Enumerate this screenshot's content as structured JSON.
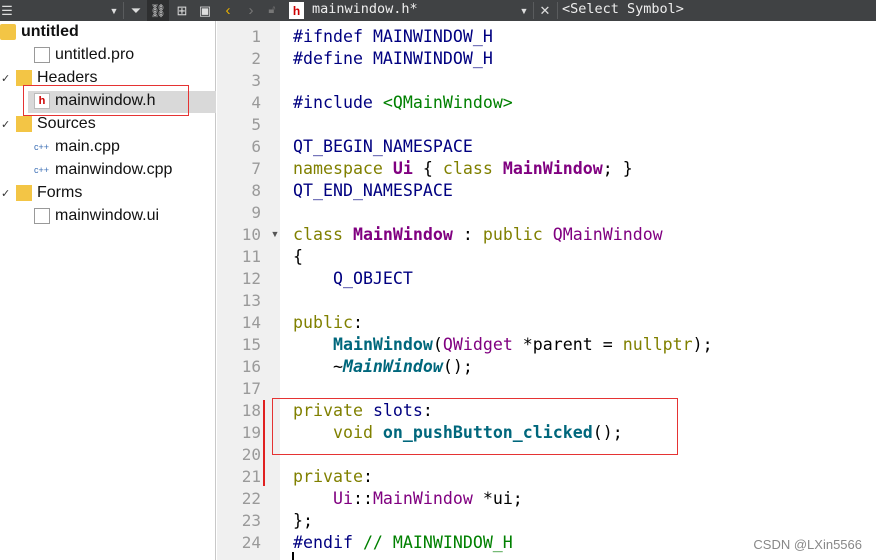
{
  "toolbar": {
    "file_tab": "mainwindow.h*",
    "symbol_select": "<Select Symbol>",
    "file_icon": "h-file-icon"
  },
  "tree": {
    "project": "untitled",
    "items": [
      {
        "label": "untitled.pro",
        "depth": 1,
        "icon": "qt-pro-file-icon"
      },
      {
        "label": "Headers",
        "depth": 0,
        "icon": "headers-folder-icon",
        "expanded": true
      },
      {
        "label": "mainwindow.h",
        "depth": 1,
        "icon": "h-file-icon",
        "selected": true
      },
      {
        "label": "Sources",
        "depth": 0,
        "icon": "sources-folder-icon",
        "expanded": true
      },
      {
        "label": "main.cpp",
        "depth": 1,
        "icon": "cpp-file-icon"
      },
      {
        "label": "mainwindow.cpp",
        "depth": 1,
        "icon": "cpp-file-icon"
      },
      {
        "label": "Forms",
        "depth": 0,
        "icon": "forms-folder-icon",
        "expanded": true
      },
      {
        "label": "mainwindow.ui",
        "depth": 1,
        "icon": "ui-file-icon"
      }
    ]
  },
  "editor": {
    "lines": [
      [
        [
          "#ifndef ",
          "pp"
        ],
        [
          "MAINWINDOW_H",
          "mac"
        ]
      ],
      [
        [
          "#define ",
          "pp"
        ],
        [
          "MAINWINDOW_H",
          "mac"
        ]
      ],
      [],
      [
        [
          "#include ",
          "pp"
        ],
        [
          "<QMainWindow>",
          "str"
        ]
      ],
      [],
      [
        [
          "QT_BEGIN_NAMESPACE",
          "mac"
        ]
      ],
      [
        [
          "namespace ",
          "kw"
        ],
        [
          "Ui",
          "tyb"
        ],
        [
          " { ",
          ""
        ],
        [
          "class ",
          "kw"
        ],
        [
          "MainWindow",
          "tyb"
        ],
        [
          "; }",
          ""
        ]
      ],
      [
        [
          "QT_END_NAMESPACE",
          "mac"
        ]
      ],
      [],
      [
        [
          "class ",
          "kw"
        ],
        [
          "MainWindow",
          "tyb"
        ],
        [
          " : ",
          ""
        ],
        [
          "public ",
          "kw"
        ],
        [
          "QMainWindow",
          "ty"
        ]
      ],
      [
        [
          "{",
          ""
        ]
      ],
      [
        [
          "    ",
          ""
        ],
        [
          "Q_OBJECT",
          "mac"
        ]
      ],
      [],
      [
        [
          "public",
          "kw"
        ],
        [
          ":",
          ""
        ]
      ],
      [
        [
          "    ",
          ""
        ],
        [
          "MainWindow",
          "fn"
        ],
        [
          "(",
          ""
        ],
        [
          "QWidget",
          "ty"
        ],
        [
          " *parent = ",
          ""
        ],
        [
          "nullptr",
          "kw"
        ],
        [
          ");",
          ""
        ]
      ],
      [
        [
          "    ~",
          ""
        ],
        [
          "MainWindow",
          "fni"
        ],
        [
          "();",
          ""
        ]
      ],
      [],
      [
        [
          "private ",
          "kw"
        ],
        [
          "slots",
          "pp"
        ],
        [
          ":",
          ""
        ]
      ],
      [
        [
          "    ",
          ""
        ],
        [
          "void ",
          "kw"
        ],
        [
          "on_pushButton_clicked",
          "fn"
        ],
        [
          "();",
          ""
        ]
      ],
      [],
      [
        [
          "private",
          "kw"
        ],
        [
          ":",
          ""
        ]
      ],
      [
        [
          "    ",
          ""
        ],
        [
          "Ui",
          "ty"
        ],
        [
          "::",
          ""
        ],
        [
          "MainWindow",
          "ty"
        ],
        [
          " *ui;",
          ""
        ]
      ],
      [
        [
          "};",
          ""
        ]
      ],
      [
        [
          "#endif ",
          "pp"
        ],
        [
          "// MAINWINDOW_H",
          "str"
        ]
      ]
    ]
  },
  "watermark": "CSDN @LXin5566"
}
